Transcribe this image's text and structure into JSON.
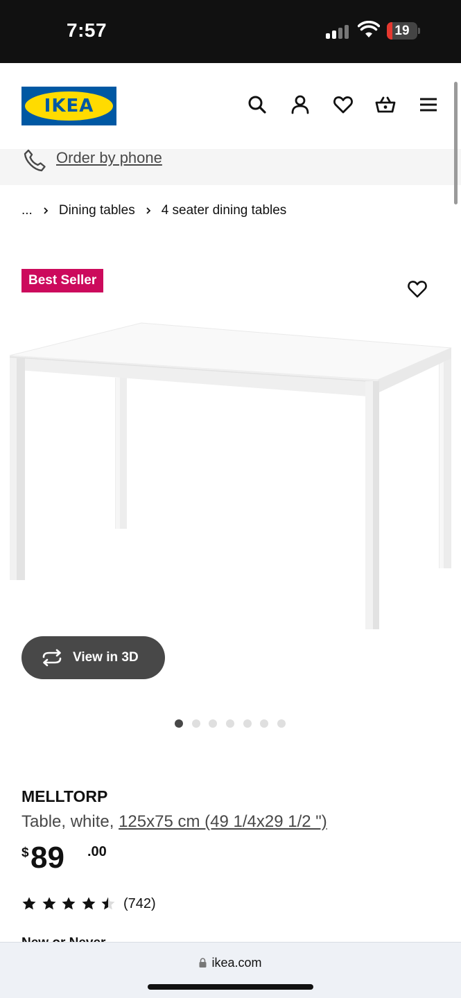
{
  "status_bar": {
    "time": "7:57",
    "battery_level": "19",
    "battery_fraction": 0.19
  },
  "header": {
    "logo_text": "IKEA",
    "brand_colors": {
      "blue": "#0058a3",
      "yellow": "#ffdb00"
    },
    "icons": [
      "search-icon",
      "account-icon",
      "wishlist-heart-icon",
      "shopping-basket-icon",
      "menu-icon"
    ]
  },
  "phone_bar": {
    "label": "Order by phone",
    "icon": "phone-icon"
  },
  "breadcrumb": {
    "ellipsis": "...",
    "items": [
      "Dining tables",
      "4 seater dining tables"
    ]
  },
  "product": {
    "badge": "Best Seller",
    "badge_color": "#cc0a5c",
    "view_3d_label": "View in 3D",
    "gallery": {
      "image_count": 7,
      "active_index": 0
    },
    "name": "MELLTORP",
    "description_prefix": "Table, white, ",
    "size_link": "125x75 cm (49 1/4x29 1/2 \")",
    "price": {
      "currency": "$",
      "integer": "89",
      "decimals": ".00"
    },
    "rating": {
      "value": 4.5,
      "max": 5,
      "count_text": "(742)"
    },
    "next_section_text": "New or Never"
  },
  "browser": {
    "url": "ikea.com"
  }
}
